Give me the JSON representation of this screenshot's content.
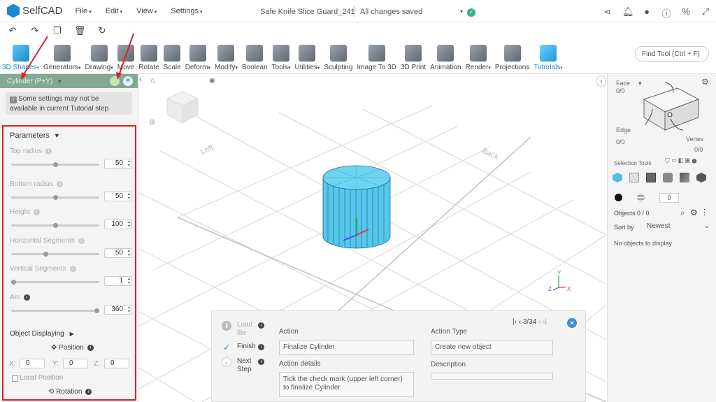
{
  "app": {
    "name": "SelfCAD",
    "menus": [
      "File",
      "Edit",
      "View",
      "Settings"
    ],
    "document_title": "Safe Knife Slice Guard_241",
    "save_status": "All changes saved",
    "top_icons": [
      "share-icon",
      "bell-icon",
      "user-icon",
      "info-icon",
      "units-icon",
      "fullscreen-icon"
    ]
  },
  "quickbar": {
    "icons": [
      "undo-icon",
      "redo-icon",
      "copy-icon",
      "delete-icon",
      "refresh-icon"
    ]
  },
  "ribbon": {
    "tools": [
      {
        "label": "3D Shapes",
        "dropdown": true
      },
      {
        "label": "Generators",
        "dropdown": true
      },
      {
        "label": "Drawing",
        "dropdown": true
      },
      {
        "label": "Move",
        "dropdown": false
      },
      {
        "label": "Rotate",
        "dropdown": false
      },
      {
        "label": "Scale",
        "dropdown": false
      },
      {
        "label": "Deform",
        "dropdown": true
      },
      {
        "label": "Modify",
        "dropdown": true
      },
      {
        "label": "Boolean",
        "dropdown": false
      },
      {
        "label": "Tools",
        "dropdown": true
      },
      {
        "label": "Utilities",
        "dropdown": true
      },
      {
        "label": "Sculpting",
        "dropdown": false
      },
      {
        "label": "Image To 3D",
        "dropdown": false
      },
      {
        "label": "3D Print",
        "dropdown": false
      },
      {
        "label": "Animation",
        "dropdown": false
      },
      {
        "label": "Render",
        "dropdown": true
      },
      {
        "label": "Projections",
        "dropdown": false
      },
      {
        "label": "Tutorials",
        "dropdown": true
      }
    ],
    "find_tool": "Find Tool (Ctrl + F)"
  },
  "left_panel": {
    "header": "Cylinder (P+Y)",
    "note": "Some settings may not be available in current Tutorial step",
    "parameters_title": "Parameters",
    "params": [
      {
        "label": "Top radius",
        "value": "50",
        "level": 0.5
      },
      {
        "label": "Bottom radius",
        "value": "50",
        "level": 0.5
      },
      {
        "label": "Height",
        "value": "100",
        "level": 0.5
      },
      {
        "label": "Horizontal Segments",
        "value": "50",
        "level": 0.39
      },
      {
        "label": "Vertical Segments",
        "value": "1",
        "level": 0.0
      },
      {
        "label": "Arc",
        "value": "360",
        "level": 1.0
      }
    ],
    "object_displaying": "Object Displaying",
    "position": "Position",
    "x_label": "X:",
    "x_value": "0",
    "y_label": "Y:",
    "y_value": "0",
    "z_label": "Z:",
    "z_value": "0",
    "local_position": "Local Position",
    "rotation": "Rotation"
  },
  "viewport": {
    "grid_label_left": "Left",
    "grid_label_back": "Back",
    "axis_x": "X",
    "axis_y": "Y",
    "axis_z": "Z"
  },
  "tutorial": {
    "steps": [
      {
        "label": "Load file",
        "state": "disabled"
      },
      {
        "label": "Finish",
        "state": "done"
      },
      {
        "label": "Next Step",
        "state": "next"
      }
    ],
    "action_label": "Action",
    "action_value": "Finalize Cylinder",
    "action_details_label": "Action details",
    "action_details_value": "Tick the check mark (upper left corner) to finalize Cylinder",
    "action_type_label": "Action Type",
    "action_type_value": "Create new object",
    "description_label": "Description",
    "description_value": "",
    "nav": "3/34"
  },
  "right_panel": {
    "face_label": "Face",
    "face_count": "0/0",
    "edge_label": "Edge",
    "edge_count": "0/0",
    "vertex_label": "Vertex",
    "vertex_count": "0/0",
    "selection_tools": "Selection Tools",
    "color_value": "0",
    "objects": "Objects 0 / 0",
    "sort_by": "Sort by",
    "sort_value": "Newest",
    "empty": "No objects to display"
  },
  "colors": {
    "accent": "#1a8ad4",
    "panel_header": "#84a992",
    "highlight": "#e02020",
    "cylinder": "#4fc3e8"
  }
}
